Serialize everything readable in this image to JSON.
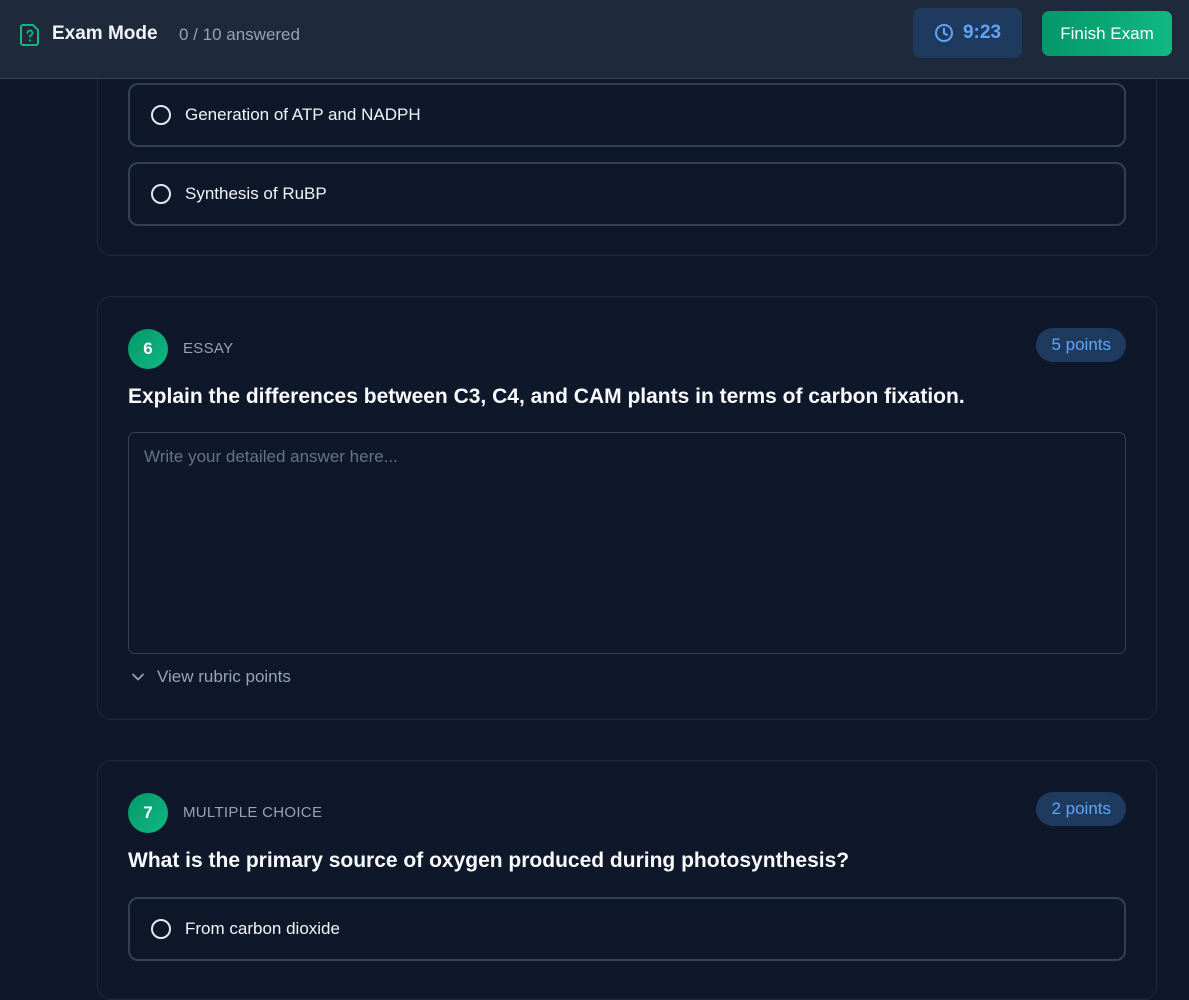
{
  "header": {
    "title": "Exam Mode",
    "progress": "0 / 10 answered",
    "timer": "9:23",
    "finish_label": "Finish Exam",
    "icons": {
      "brand": "file-question-icon",
      "timer": "clock-icon"
    }
  },
  "colors": {
    "accent": "#10b981",
    "timer_text": "#60a5fa",
    "background": "#0f172a"
  },
  "question5": {
    "options": [
      "Generation of ATP and NADPH",
      "Synthesis of RuBP"
    ]
  },
  "question6": {
    "number": "6",
    "type": "ESSAY",
    "points": "5 points",
    "text": "Explain the differences between C3, C4, and CAM plants in terms of carbon fixation.",
    "placeholder": "Write your detailed answer here...",
    "rubric_label": "View rubric points",
    "rubric_icon": "chevron-down-icon"
  },
  "question7": {
    "number": "7",
    "type": "MULTIPLE CHOICE",
    "points": "2 points",
    "text": "What is the primary source of oxygen produced during photosynthesis?",
    "options": [
      "From carbon dioxide"
    ]
  }
}
